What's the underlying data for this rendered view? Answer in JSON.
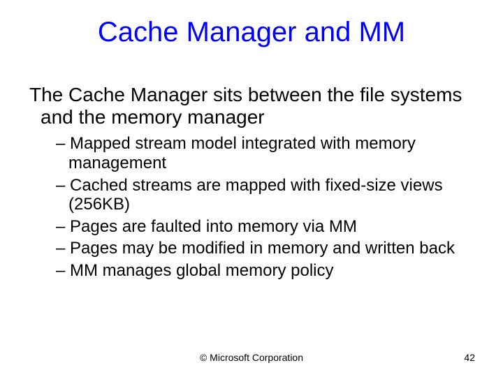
{
  "slide": {
    "title": "Cache Manager and MM",
    "paragraph": "The Cache Manager sits between the file systems and the memory manager",
    "bullets": [
      "Mapped stream model integrated with memory management",
      "Cached streams are mapped with fixed-size views (256KB)",
      "Pages are faulted into memory via MM",
      "Pages may be modified in memory and written back",
      "MM manages global memory policy"
    ],
    "footer": {
      "copyright": "© Microsoft Corporation",
      "page_number": "42"
    }
  }
}
